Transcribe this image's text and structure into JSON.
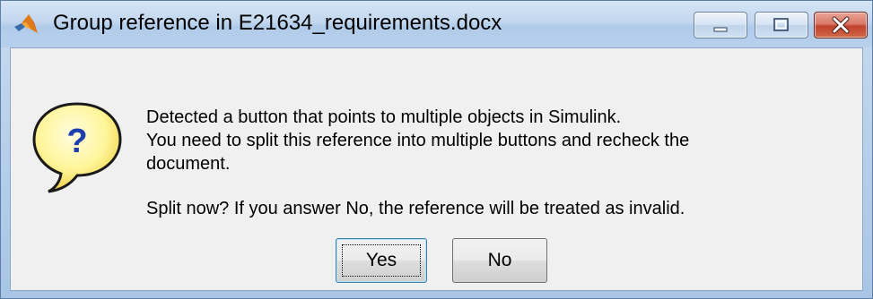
{
  "window": {
    "title": "Group reference in E21634_requirements.docx",
    "app_icon": "matlab-logo-icon",
    "caption_buttons": {
      "minimize_icon": "minimize-icon",
      "maximize_icon": "maximize-icon",
      "close_icon": "close-icon"
    },
    "colors": {
      "titlebar": "#c2d7ef",
      "close_button": "#c2412d",
      "client_background": "#f0f0f0"
    }
  },
  "dialog": {
    "icon": "question-bubble-icon",
    "icon_glyph": "?",
    "message_lines": [
      "Detected a button that points to multiple objects in Simulink.",
      "You need to split this reference into multiple buttons and recheck the",
      "document."
    ],
    "question": "Split now?  If you answer No, the reference will be treated as invalid.",
    "buttons": {
      "yes_label": "Yes",
      "no_label": "No",
      "default": "Yes"
    }
  }
}
